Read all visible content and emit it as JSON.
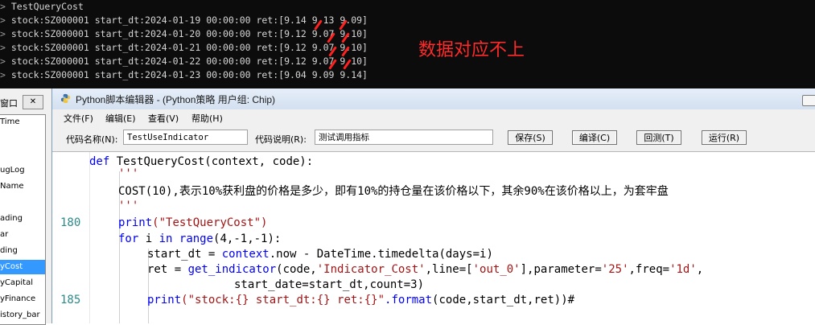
{
  "console": {
    "prefix": ">",
    "lines": [
      "TestQueryCost",
      "stock:SZ000001 start_dt:2024-01-19 00:00:00 ret:[9.14 9.13 9.09]",
      "stock:SZ000001 start_dt:2024-01-20 00:00:00 ret:[9.12 9.07 9.10]",
      "stock:SZ000001 start_dt:2024-01-21 00:00:00 ret:[9.12 9.07 9.10]",
      "stock:SZ000001 start_dt:2024-01-22 00:00:00 ret:[9.12 9.07 9.10]",
      "stock:SZ000001 start_dt:2024-01-23 00:00:00 ret:[9.04 9.09 9.14]"
    ],
    "annotation": "数据对应不上",
    "annotation_color": "#ff2a2a"
  },
  "left_panel": {
    "title": "窗口",
    "close_label": "✕",
    "items": [
      "Time",
      "",
      "",
      "ugLog",
      "Name",
      "",
      "ading",
      "ar",
      "ding",
      "yCost",
      "yCapital",
      "yFinance",
      "istory_bar"
    ],
    "selected_index": 9
  },
  "editor": {
    "title": "Python脚本编辑器 - (Python策略 用户组: Chip)",
    "menu": [
      "文件(F)",
      "编辑(E)",
      "查看(V)",
      "帮助(H)"
    ],
    "toolbar": {
      "code_name_label": "代码名称(N):",
      "code_name_value": "TestUseIndicator",
      "code_desc_label": "代码说明(R):",
      "code_desc_value": "测试调用指标",
      "save_label": "保存(S)",
      "compile_label": "编译(C)",
      "test_label": "回测(T)",
      "run_label": "运行(R)"
    },
    "line_numbers": {
      "l180": "180",
      "l185": "185"
    },
    "code": {
      "l1_kw": "def",
      "l1_rest": " TestQueryCost(context, code):",
      "l2": "'''",
      "l3": "COST(10),表示10%获利盘的价格是多少，即有10%的持仓量在该价格以下，其余90%在该价格以上，为套牢盘",
      "l4": "'''",
      "l5_kw": "print",
      "l5_str": "(\"TestQueryCost\")",
      "l6_kw1": "for",
      "l6_a": " i ",
      "l6_kw2": "in",
      "l6_sp": " ",
      "l6_kw3": "range",
      "l6_b": "(4,-1,-1):",
      "l7_a": "start_dt = ",
      "l7_kw": "context",
      "l7_b": ".now - DateTime.timedelta(days=i)",
      "l8_a": "ret = ",
      "l8_kw": "get_indicator",
      "l8_b": "(code,",
      "l8_s1": "'Indicator_Cost'",
      "l8_c": ",line=[",
      "l8_s2": "'out_0'",
      "l8_d": "],parameter=",
      "l8_s3": "'25'",
      "l8_e": ",freq=",
      "l8_s4": "'1d'",
      "l8_f": ",",
      "l9": "start_date=start_dt,count=3)",
      "l10_kw": "print",
      "l10_str": "(\"stock:{} start_dt:{} ret:{}\"",
      "l10_kw2": ".format",
      "l10_rest": "(code,start_dt,ret))#"
    }
  }
}
